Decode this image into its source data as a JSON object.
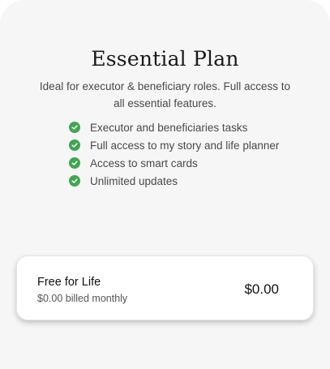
{
  "plan": {
    "title": "Essential Plan",
    "description": "Ideal for executor & beneficiary roles. Full access to all essential features.",
    "features": [
      "Executor and beneficiaries tasks",
      "Full access to my story and life planner",
      "Access to smart cards",
      "Unlimited updates"
    ],
    "feature_icon": "check-circle-icon",
    "accent_color": "#3fa751"
  },
  "option": {
    "name": "Free for Life",
    "billing": "$0.00 billed monthly",
    "price": "$0.00"
  }
}
